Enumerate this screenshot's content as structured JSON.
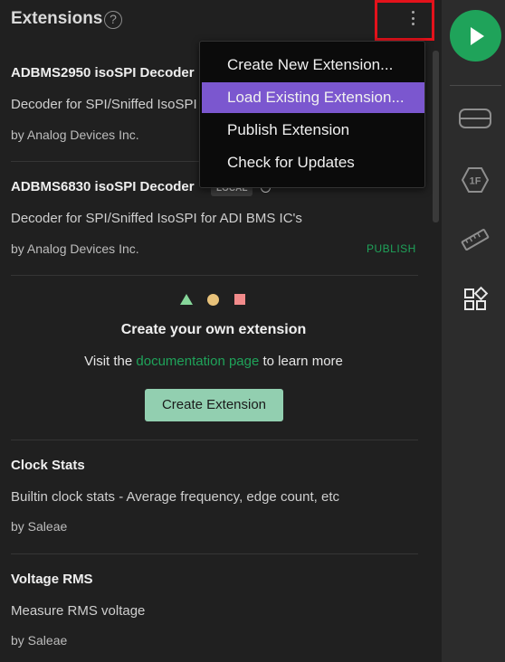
{
  "header": {
    "title": "Extensions",
    "help_glyph": "?"
  },
  "menu": {
    "items": [
      {
        "label": "Create New Extension..."
      },
      {
        "label": "Load Existing Extension..."
      },
      {
        "label": "Publish Extension"
      },
      {
        "label": "Check for Updates"
      }
    ],
    "active_index": 1
  },
  "extensions": [
    {
      "title": "ADBMS2950 isoSPI Decoder",
      "description": "Decoder for SPI/Sniffed IsoSPI",
      "author": "by Analog Devices Inc."
    },
    {
      "title": "ADBMS6830 isoSPI Decoder",
      "badge": "LOCAL",
      "description": "Decoder for SPI/Sniffed IsoSPI for ADI BMS IC's",
      "author": "by Analog Devices Inc.",
      "action": "PUBLISH"
    },
    {
      "title": "Clock Stats",
      "description": "Builtin clock stats - Average frequency, edge count, etc",
      "author": "by Saleae"
    },
    {
      "title": "Voltage RMS",
      "description": "Measure RMS voltage",
      "author": "by Saleae"
    }
  ],
  "create_section": {
    "title": "Create your own extension",
    "visit_prefix": "Visit the ",
    "link_text": "documentation page",
    "visit_suffix": " to learn more",
    "button_label": "Create Extension"
  },
  "sidebar": {
    "items": [
      {
        "icon": "play-icon"
      },
      {
        "icon": "device-icon"
      },
      {
        "icon": "1f-hex-icon",
        "label": "1F"
      },
      {
        "icon": "ruler-icon"
      },
      {
        "icon": "extensions-icon"
      }
    ]
  },
  "colors": {
    "accent_green": "#1fa35a",
    "menu_active": "#7b57cf",
    "highlight_box": "#e3121b",
    "button_bg": "#92cfb0"
  }
}
